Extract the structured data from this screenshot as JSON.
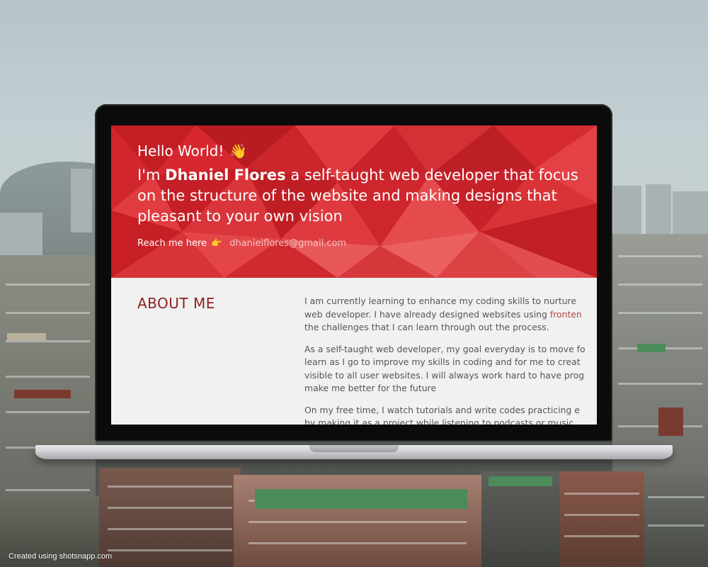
{
  "hero": {
    "greeting": "Hello World!",
    "greeting_icon": "waving-hand-icon",
    "intro_prefix": "I'm",
    "name": "Dhaniel Flores",
    "intro_line1_rest": "a self-taught web developer that focus",
    "intro_line2": "on the structure of the website and making designs that",
    "intro_line3": "pleasant to your own vision",
    "reach_label": "Reach me here",
    "reach_icon": "pointing-hand-icon",
    "email": "dhanielflores@gmail.com",
    "accent_color": "#d2232a"
  },
  "about": {
    "title": "ABOUT ME",
    "title_color": "#8f1f1f",
    "p1_line1": "I am currently learning to enhance my coding skills to nurture",
    "p1_line2_prefix": "web developer. I have already designed websites using ",
    "p1_line2_highlight": "fronten",
    "p1_line3": "the challenges that I can learn through out the process.",
    "p2_line1": "As a self-taught web developer, my goal everyday is to move fo",
    "p2_line2": "learn as I go to improve my skills in coding and for me to creat",
    "p2_line3": "visible to all user websites. I will always work hard to have prog",
    "p2_line4": "make me better for the future",
    "p3_line1": "On my free time, I watch tutorials and write codes practicing e",
    "p3_line2": "by making it as a project while listening to podcasts or music."
  },
  "watermark": "Created using shotsnapp.com"
}
